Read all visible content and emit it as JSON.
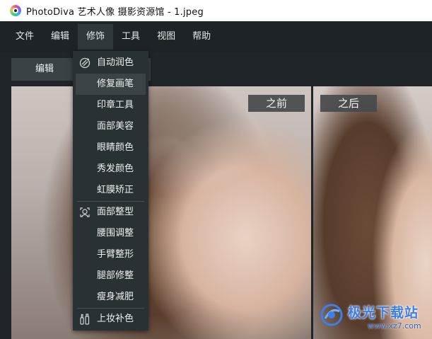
{
  "window": {
    "title": "PhotoDiva 艺术人像 摄影资源馆 - 1.jpeg",
    "logo_icon": "photodiva-logo-icon"
  },
  "menubar": {
    "items": [
      {
        "label": "文件"
      },
      {
        "label": "编辑"
      },
      {
        "label": "修饰",
        "active": true
      },
      {
        "label": "工具"
      },
      {
        "label": "视图"
      },
      {
        "label": "帮助"
      }
    ]
  },
  "toolbar": {
    "edit_tab_label": "编辑"
  },
  "compare": {
    "before_label": "之前",
    "after_label": "之后"
  },
  "dropdown": {
    "items": [
      {
        "label": "自动润色",
        "icon": "auto-retouch-icon"
      },
      {
        "label": "修复画笔",
        "hover": true
      },
      {
        "label": "印章工具"
      },
      {
        "label": "面部美容"
      },
      {
        "label": "眼睛颜色"
      },
      {
        "label": "秀发颜色"
      },
      {
        "label": "虹膜矫正"
      },
      {
        "label": "面部整型",
        "icon": "face-sculpt-icon"
      },
      {
        "label": "腰围调整"
      },
      {
        "label": "手臂整形"
      },
      {
        "label": "腿部修整"
      },
      {
        "label": "瘦身减肥"
      },
      {
        "label": "上妆补色",
        "icon": "makeup-icon"
      }
    ]
  },
  "watermark": {
    "title": "极光下载站",
    "url": "www.xz7.com"
  },
  "colors": {
    "menubar_bg": "#1d2326",
    "dropdown_bg": "#2a3134",
    "watermark_blue": "#3d7ee8"
  }
}
